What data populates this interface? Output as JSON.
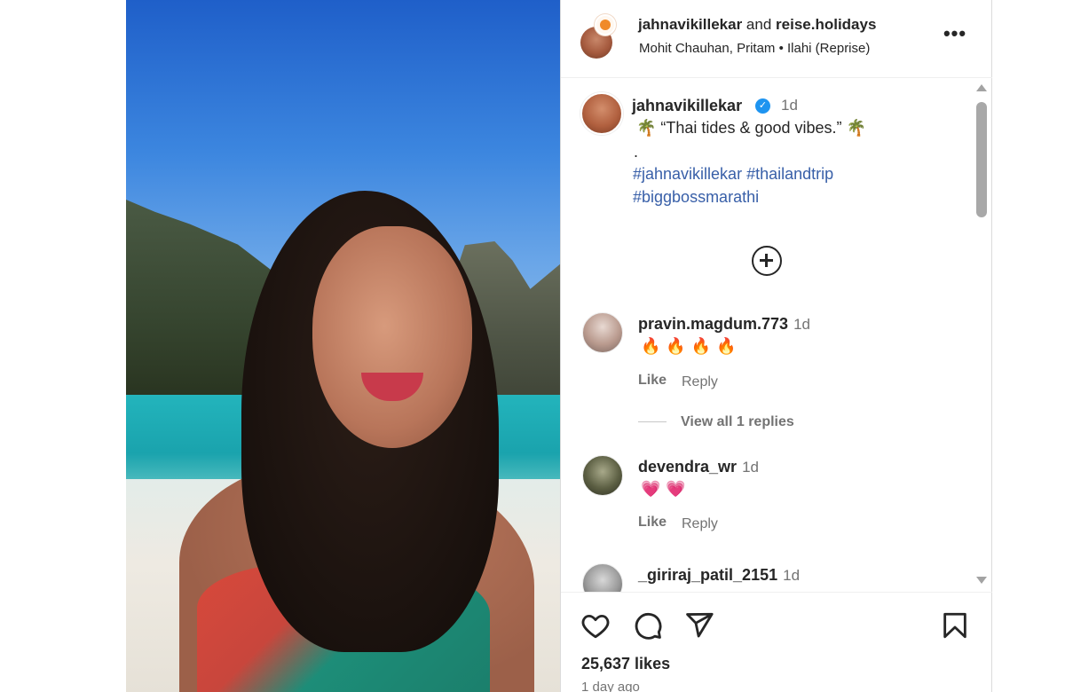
{
  "header": {
    "user1": "jahnavikillekar",
    "and": "and",
    "user2": "reise.holidays",
    "audio": "Mohit Chauhan, Pritam • Ilahi (Reprise)",
    "more_icon": "more-horizontal-icon"
  },
  "caption": {
    "username": "jahnavikillekar",
    "verified_icon": "verified-badge-icon",
    "time": "1d",
    "text": "🌴 “Thai tides & good vibes.” 🌴",
    "dot": ".",
    "hashtags_line1": "#jahnavikillekar #thailandtrip",
    "hashtags_line2": "#biggbossmarathi"
  },
  "comments": [
    {
      "username": "pravin.magdum.773",
      "time": "1d",
      "text": "🔥🔥🔥🔥",
      "like": "Like",
      "reply": "Reply",
      "view_replies": "View all 1 replies"
    },
    {
      "username": "devendra_wr",
      "time": "1d",
      "text": "💗💗",
      "like": "Like",
      "reply": "Reply"
    },
    {
      "username": "_giriraj_patil_2151",
      "time": "1d"
    }
  ],
  "actions": {
    "icons": [
      "heart-icon",
      "comment-icon",
      "share-icon",
      "bookmark-icon"
    ],
    "likes": "25,637 likes",
    "posted": "1 day ago"
  },
  "colors": {
    "hashtag": "#385fa8",
    "verified": "#1e94f0",
    "muted": "#737373",
    "text": "#262626"
  }
}
